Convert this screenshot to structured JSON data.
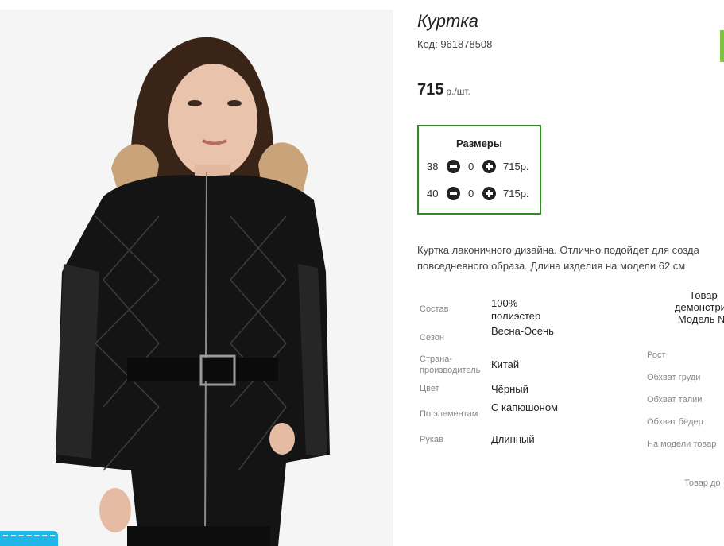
{
  "product": {
    "title": "Куртка",
    "code": "Код: 961878508",
    "price_amount": "715",
    "price_unit": "р./шт."
  },
  "sizes": {
    "heading": "Размеры",
    "rows": [
      {
        "size": "38",
        "qty": "0",
        "price": "715р."
      },
      {
        "size": "40",
        "qty": "0",
        "price": "715р."
      }
    ]
  },
  "description": {
    "line1": "Куртка лаконичного дизайна. Отлично подойдет для созда",
    "line2": "повседневного образа. Длина изделия на модели 62 см"
  },
  "attributes": [
    {
      "label": "Состав",
      "value": "100% полиэстер"
    },
    {
      "label": "Сезон",
      "value": "Весна-Осень"
    },
    {
      "label": "Страна-производитель",
      "value": "Китай"
    },
    {
      "label": "Цвет",
      "value": "Чёрный"
    },
    {
      "label": "По элементам",
      "value": "С капюшоном"
    },
    {
      "label": "Рукав",
      "value": "Длинный"
    }
  ],
  "model": {
    "heading_1": "Товар",
    "heading_2": "демонстрир",
    "heading_3": "Модель №",
    "params": [
      "Рост",
      "Обхват груди",
      "Обхват талии",
      "Обхват бёдер",
      "На модели товар"
    ],
    "notice": "Товар до"
  },
  "colors": {
    "accent_green": "#2e8b22",
    "edge_green": "#7dc242",
    "promo_blue": "#1fb6e8"
  }
}
